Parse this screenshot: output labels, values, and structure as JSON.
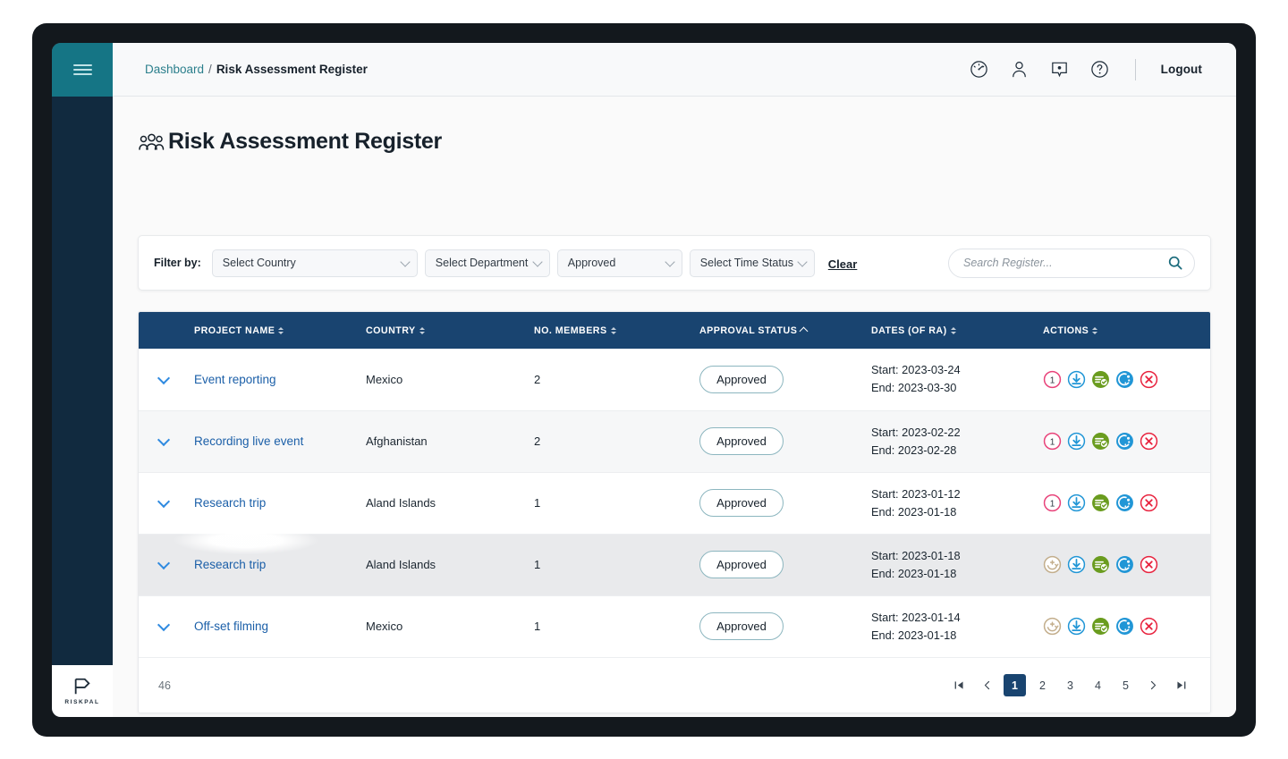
{
  "sidebar": {
    "menu_button": "menu-hamburger",
    "logo_text": "RISKPAL"
  },
  "topbar": {
    "breadcrumb": {
      "root": "Dashboard",
      "separator": "/",
      "current": "Risk Assessment Register"
    },
    "icons": [
      "dashboard-gauge-icon",
      "user-profile-icon",
      "feedback-message-icon",
      "help-question-icon"
    ],
    "logout_label": "Logout"
  },
  "page": {
    "title": "Risk Assessment Register"
  },
  "filters": {
    "label": "Filter by:",
    "country": {
      "value": "Select Country"
    },
    "department": {
      "value": "Select Department"
    },
    "approval": {
      "value": "Approved"
    },
    "time_status": {
      "value": "Select Time Status"
    },
    "clear_label": "Clear",
    "search": {
      "value": "",
      "placeholder": "Search Register..."
    }
  },
  "table": {
    "columns": [
      {
        "key": "expander",
        "label": "",
        "sort": "none"
      },
      {
        "key": "project_name",
        "label": "PROJECT NAME",
        "sort": "both"
      },
      {
        "key": "country",
        "label": "COUNTRY",
        "sort": "both"
      },
      {
        "key": "members",
        "label": "NO. MEMBERS",
        "sort": "both"
      },
      {
        "key": "approval_status",
        "label": "APPROVAL STATUS",
        "sort": "asc"
      },
      {
        "key": "dates",
        "label": "DATES (OF RA)",
        "sort": "both"
      },
      {
        "key": "actions",
        "label": "ACTIONS",
        "sort": "both"
      }
    ],
    "rows": [
      {
        "project_name": "Event reporting",
        "country": "Mexico",
        "members": "2",
        "approval_status": "Approved",
        "start": "Start: 2023-03-24",
        "end": "End: 2023-03-30",
        "first_action": "counter-badge-1",
        "first_action_label": "1",
        "actions": [
          "counter-badge-1",
          "download-icon",
          "document-approved-icon",
          "share-globe-icon",
          "delete-close-icon"
        ]
      },
      {
        "project_name": "Recording live event",
        "country": "Afghanistan",
        "members": "2",
        "approval_status": "Approved",
        "start": "Start: 2023-02-22",
        "end": "End: 2023-02-28",
        "first_action": "counter-badge-1",
        "first_action_label": "1",
        "actions": [
          "counter-badge-1",
          "download-icon",
          "document-approved-icon",
          "share-globe-icon",
          "delete-close-icon"
        ]
      },
      {
        "project_name": "Research trip",
        "country": "Aland Islands",
        "members": "1",
        "approval_status": "Approved",
        "start": "Start: 2023-01-12",
        "end": "End: 2023-01-18",
        "first_action": "counter-badge-1",
        "first_action_label": "1",
        "actions": [
          "counter-badge-1",
          "download-icon",
          "document-approved-icon",
          "share-globe-icon",
          "delete-close-icon"
        ]
      },
      {
        "project_name": "Research trip",
        "country": "Aland Islands",
        "members": "1",
        "approval_status": "Approved",
        "start": "Start: 2023-01-18",
        "end": "End: 2023-01-18",
        "first_action": "renew-add-icon",
        "first_action_label": "",
        "actions": [
          "renew-add-icon",
          "download-icon",
          "document-approved-icon",
          "share-globe-icon",
          "delete-close-icon"
        ]
      },
      {
        "project_name": "Off-set filming",
        "country": "Mexico",
        "members": "1",
        "approval_status": "Approved",
        "start": "Start: 2023-01-14",
        "end": "End: 2023-01-18",
        "first_action": "renew-add-icon",
        "first_action_label": "",
        "actions": [
          "renew-add-icon",
          "download-icon",
          "document-approved-icon",
          "share-globe-icon",
          "delete-close-icon"
        ]
      }
    ]
  },
  "pagination": {
    "total": "46",
    "pages": [
      "1",
      "2",
      "3",
      "4",
      "5"
    ],
    "active_page": "1",
    "first_label": "first-page-icon",
    "prev_label": "previous-page-icon",
    "next_label": "next-page-icon",
    "last_label": "last-page-icon"
  },
  "colors": {
    "sidebar": "#112a3f",
    "teal": "#157585",
    "table_header": "#194470",
    "link": "#1b5fa8",
    "breadcrumb_link": "#2b7f8c",
    "action_pink": "#e8437a",
    "action_blue": "#2196d6",
    "action_green": "#6a9c1f",
    "action_red": "#e8243f",
    "action_tan": "#c3ae8c"
  }
}
